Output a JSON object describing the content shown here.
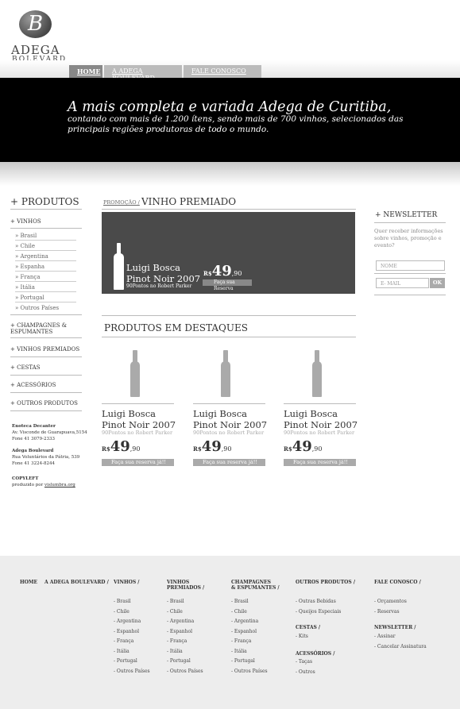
{
  "brand": {
    "monogram": "B",
    "name": "ADEGA",
    "sub": "BOLEVARD"
  },
  "tabs": [
    {
      "label": "HOME"
    },
    {
      "label": "A ADEGA BOULEVARD"
    },
    {
      "label": "FALE CONOSCO"
    }
  ],
  "hero": {
    "headline": "A mais completa e variada Adega de Curitiba,",
    "text": "contando com mais de 1.200 ítens, sendo mais de 700 vinhos, selecionados das principais regiões produtoras de todo o mundo."
  },
  "sidebar": {
    "title": "+ PRODUTOS",
    "vinhos": "+ VINHOS",
    "vinhos_items": [
      "» Brasil",
      "» Chile",
      "» Argentina",
      "» Espanha",
      "» França",
      "» Itália",
      "» Portugal",
      "» Outros Países"
    ],
    "champagnes": "+ CHAMPAGNES & ESPUMANTES",
    "premiados": "+ VINHOS PREMIADOS",
    "cestas": "+ CESTAS",
    "acessorios": "+ ACESSÓRIOS",
    "outros": "+ OUTROS PRODUTOS",
    "store1_name": "Enoteca Decanter",
    "store1_addr": "Av. Visconde de Guarapuava,5154",
    "store1_phone": "Fone 41 3079-2333",
    "store2_name": "Adega Boulevard",
    "store2_addr": "Rua Voluntários da Pátria, 539",
    "store2_phone": "Fone 41 3224-8244",
    "copyleft": "COPYLEFT",
    "produzido": "produzido por",
    "produzido_link": "vislumbra.org"
  },
  "breadcrumb": {
    "small": "PROMOÇÃO /",
    "title": "VINHO PREMIADO"
  },
  "feature": {
    "name1": "Luigi Bosca",
    "name2": "Pinot Noir 2007",
    "note": "90Pontos no Robert Parker",
    "currency": "R$",
    "price_int": "49",
    "price_dec": ",90",
    "button": "Faça sua Reserva"
  },
  "destaques": {
    "title": "PRODUTOS EM DESTAQUES",
    "items": [
      {
        "name1": "Luigi Bosca",
        "name2": "Pinot Noir 2007",
        "note": "90Pontos no Robert Parker",
        "currency": "R$",
        "price_int": "49",
        "price_dec": ",90",
        "button": "Faça sua reserva já!!"
      },
      {
        "name1": "Luigi Bosca",
        "name2": "Pinot Noir 2007",
        "note": "90Pontos no Robert Parker",
        "currency": "R$",
        "price_int": "49",
        "price_dec": ",90",
        "button": "Faça sua reserva já!!"
      },
      {
        "name1": "Luigi Bosca",
        "name2": "Pinot Noir 2007",
        "note": "90Pontos no Robert Parker",
        "currency": "R$",
        "price_int": "49",
        "price_dec": ",90",
        "button": "Faça sua reserva já!!"
      }
    ]
  },
  "newsletter": {
    "title": "+ NEWSLETTER",
    "text": "Quer receber informações sobre vinhos, promoção e evento?",
    "name_placeholder": "NOME",
    "email_placeholder": "E- MAIL",
    "ok": "OK"
  },
  "footer": {
    "home": "HOME",
    "adega": "A ADEGA BOULEVARD /",
    "vinhos": "VINHOS /",
    "vinhos_items": [
      "- Brasil",
      "- Chile",
      "- Argentina",
      "- Espanhol",
      "- França",
      "- Itália",
      "- Portugal",
      "- Outros Países"
    ],
    "premiados1": "VINHOS",
    "premiados2": "PREMIADOS /",
    "premiados_items": [
      "- Brasil",
      "- Chile",
      "- Argentina",
      "- Espanhol",
      "- França",
      "- Itália",
      "- Portugal",
      "- Outros Países"
    ],
    "champ1": "CHAMPAGNES",
    "champ2": "& ESPUMANTES /",
    "champ_items": [
      "- Brasil",
      "- Chile",
      "- Argentina",
      "- Espanhol",
      "- França",
      "- Itália",
      "- Portugal",
      "- Outros Países"
    ],
    "outros": "OUTROS PRODUTOS /",
    "outros_items": [
      "- Outras Bebidas",
      "- Queijos Especiais"
    ],
    "cestas": "CESTAS /",
    "cestas_items": [
      "- Kits"
    ],
    "acessorios": "ACESSÓRIOS /",
    "acessorios_items": [
      "- Taças",
      "- Outros"
    ],
    "fale": "FALE CONOSCO /",
    "fale_items": [
      "- Orçamentos",
      "- Reservas"
    ],
    "newsletter": "NEWSLETTER /",
    "newsletter_items": [
      "- Assinar",
      "- Cancelar Assinatura"
    ]
  }
}
